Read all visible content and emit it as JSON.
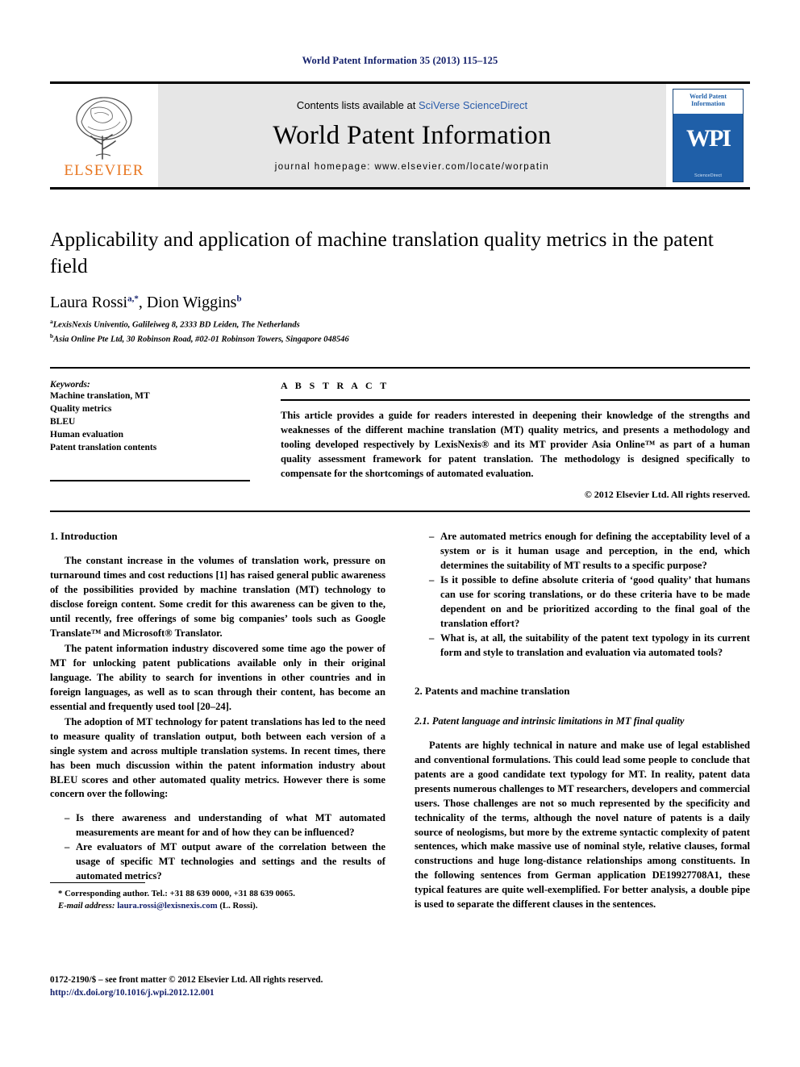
{
  "running_head": "World Patent Information 35 (2013) 115–125",
  "masthead": {
    "contents_prefix": "Contents lists available at ",
    "sciencedirect": "SciVerse ScienceDirect",
    "journal_title": "World Patent Information",
    "homepage": "journal homepage: www.elsevier.com/locate/worpatin",
    "publisher_name": "ELSEVIER",
    "publisher_logo_icon": "elsevier-tree-icon",
    "cover": {
      "title_line1": "World Patent",
      "title_line2": "Information",
      "monogram": "WPI",
      "footer": "ScienceDirect"
    }
  },
  "article": {
    "title": "Applicability and application of machine translation quality metrics in the patent field",
    "authors": [
      {
        "name": "Laura Rossi",
        "marks": "a,*"
      },
      {
        "name": "Dion Wiggins",
        "marks": "b"
      }
    ],
    "affiliations": [
      {
        "mark": "a",
        "text": "LexisNexis Univentio, Galileiweg 8, 2333 BD Leiden, The Netherlands"
      },
      {
        "mark": "b",
        "text": "Asia Online Pte Ltd, 30 Robinson Road, #02-01 Robinson Towers, Singapore 048546"
      }
    ]
  },
  "keywords": {
    "heading": "Keywords:",
    "items": [
      "Machine translation, MT",
      "Quality metrics",
      "BLEU",
      "Human evaluation",
      "Patent translation contents"
    ]
  },
  "abstract": {
    "heading": "A B S T R A C T",
    "text": "This article provides a guide for readers interested in deepening their knowledge of the strengths and weaknesses of the different machine translation (MT) quality metrics, and presents a methodology and tooling developed respectively by LexisNexis® and its MT provider Asia Online™ as part of a human quality assessment framework for patent translation. The methodology is designed specifically to compensate for the shortcomings of automated evaluation.",
    "copyright": "© 2012 Elsevier Ltd. All rights reserved."
  },
  "sections": {
    "introduction_heading": "1. Introduction",
    "intro_paragraphs": [
      "The constant increase in the volumes of translation work, pressure on turnaround times and cost reductions [1] has raised general public awareness of the possibilities provided by machine translation (MT) technology to disclose foreign content. Some credit for this awareness can be given to the, until recently, free offerings of some big companies’ tools such as Google Translate™ and Microsoft® Translator.",
      "The patent information industry discovered some time ago the power of MT for unlocking patent publications available only in their original language. The ability to search for inventions in other countries and in foreign languages, as well as to scan through their content, has become an essential and frequently used tool [20–24].",
      "The adoption of MT technology for patent translations has led to the need to measure quality of translation output, both between each version of a single system and across multiple translation systems. In recent times, there has been much discussion within the patent information industry about BLEU scores and other automated quality metrics. However there is some concern over the following:"
    ],
    "intro_bullets_left": [
      "Is there awareness and understanding of what MT automated measurements are meant for and of how they can be influenced?",
      "Are evaluators of MT output aware of the correlation between the usage of specific MT technologies and settings and the results of automated metrics?"
    ],
    "intro_bullets_right": [
      "Are automated metrics enough for defining the acceptability level of a system or is it human usage and perception, in the end, which determines the suitability of MT results to a specific purpose?",
      "Is it possible to define absolute criteria of ‘good quality’ that humans can use for scoring translations, or do these criteria have to be made dependent on and be prioritized according to the final goal of the translation effort?",
      "What is, at all, the suitability of the patent text typology in its current form and style to translation and evaluation via automated tools?"
    ],
    "patents_heading": "2. Patents and machine translation",
    "subsection_heading": "2.1. Patent language and intrinsic limitations in MT final quality",
    "patents_paragraph": "Patents are highly technical in nature and make use of legal established and conventional formulations. This could lead some people to conclude that patents are a good candidate text typology for MT. In reality, patent data presents numerous challenges to MT researchers, developers and commercial users. Those challenges are not so much represented by the specificity and technicality of the terms, although the novel nature of patents is a daily source of neologisms, but more by the extreme syntactic complexity of patent sentences, which make massive use of nominal style, relative clauses, formal constructions and huge long-distance relationships among constituents. In the following sentences from German application DE19927708A1, these typical features are quite well-exemplified. For better analysis, a double pipe is used to separate the different clauses in the sentences."
  },
  "footnote": {
    "corresponding": "* Corresponding author. Tel.: +31 88 639 0000, +31 88 639 0065.",
    "email_label": "E-mail address:",
    "email": "laura.rossi@lexisnexis.com",
    "email_suffix": "(L. Rossi)."
  },
  "page_footer": {
    "issn_line": "0172-2190/$ – see front matter © 2012 Elsevier Ltd. All rights reserved.",
    "doi_line": "http://dx.doi.org/10.1016/j.wpi.2012.12.001"
  }
}
